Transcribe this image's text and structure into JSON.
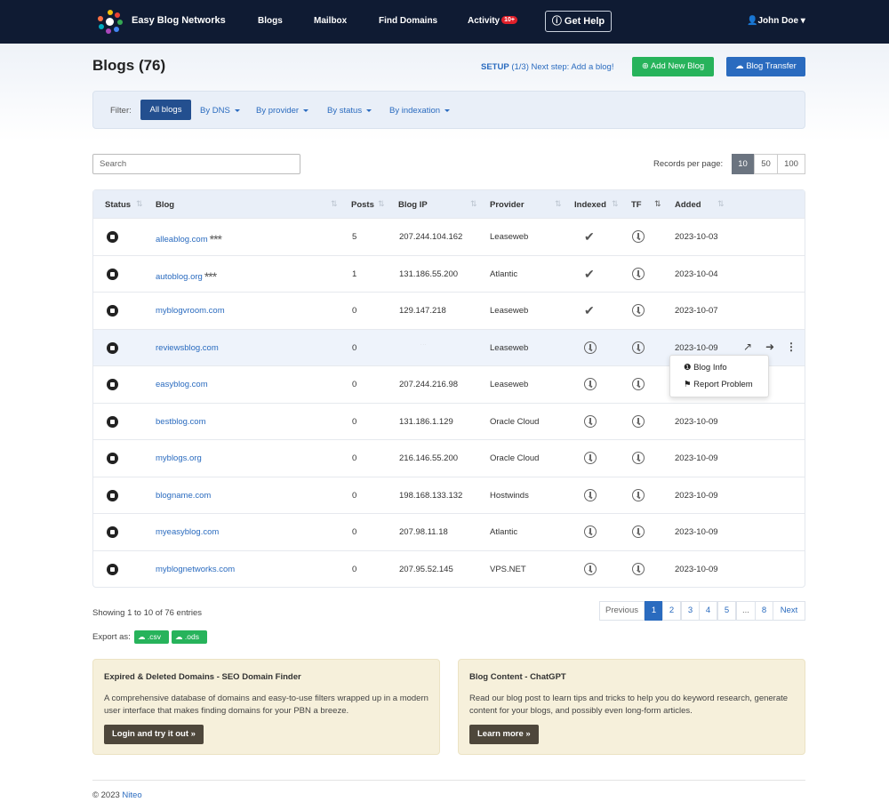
{
  "nav": {
    "brand": "Easy Blog Networks",
    "links": [
      "Blogs",
      "Mailbox",
      "Find Domains",
      "Activity"
    ],
    "activity_badge": "10+",
    "help": "Get Help",
    "user": "John Doe"
  },
  "page": {
    "title": "Blogs (76)",
    "setup_prefix": "SETUP",
    "setup_step": "(1/3)",
    "setup_text": "Next step: Add a blog!",
    "add_button": "Add New Blog",
    "transfer_button": "Blog Transfer"
  },
  "filters": {
    "label": "Filter:",
    "active": "All blogs",
    "dropdowns": [
      "By DNS",
      "By provider",
      "By status",
      "By indexation"
    ]
  },
  "search": {
    "placeholder": "Search"
  },
  "records": {
    "label": "Records per page:",
    "options": [
      "10",
      "50",
      "100"
    ],
    "selected": "10"
  },
  "table": {
    "headers": [
      "Status",
      "Blog",
      "Posts",
      "Blog IP",
      "Provider",
      "Indexed",
      "TF",
      "Added"
    ],
    "rows": [
      {
        "blog": "alleablog.com",
        "stars": "***",
        "posts": "5",
        "ip": "207.244.104.162",
        "provider": "Leaseweb",
        "indexed": "check",
        "added": "2023-10-03"
      },
      {
        "blog": "autoblog.org",
        "stars": "***",
        "posts": "1",
        "ip": "131.186.55.200",
        "provider": "Atlantic",
        "indexed": "check",
        "added": "2023-10-04"
      },
      {
        "blog": "myblogvroom.com",
        "stars": "",
        "posts": "0",
        "ip": "129.147.218",
        "provider": "Leaseweb",
        "indexed": "check",
        "added": "2023-10-07"
      },
      {
        "blog": "reviewsblog.com",
        "stars": "",
        "posts": "0",
        "ip": "",
        "provider": "Leaseweb",
        "indexed": "clock",
        "added": "2023-10-09"
      },
      {
        "blog": "easyblog.com",
        "stars": "",
        "posts": "0",
        "ip": "207.244.216.98",
        "provider": "Leaseweb",
        "indexed": "clock",
        "added": ""
      },
      {
        "blog": "bestblog.com",
        "stars": "",
        "posts": "0",
        "ip": "131.186.1.129",
        "provider": "Oracle Cloud",
        "indexed": "clock",
        "added": "2023-10-09"
      },
      {
        "blog": "myblogs.org",
        "stars": "",
        "posts": "0",
        "ip": "216.146.55.200",
        "provider": "Oracle Cloud",
        "indexed": "clock",
        "added": "2023-10-09"
      },
      {
        "blog": "blogname.com",
        "stars": "",
        "posts": "0",
        "ip": "198.168.133.132",
        "provider": "Hostwinds",
        "indexed": "clock",
        "added": "2023-10-09"
      },
      {
        "blog": "myeasyblog.com",
        "stars": "",
        "posts": "0",
        "ip": "207.98.11.18",
        "provider": "Atlantic",
        "indexed": "clock",
        "added": "2023-10-09"
      },
      {
        "blog": "myblognetworks.com",
        "stars": "",
        "posts": "0",
        "ip": "207.95.52.145",
        "provider": "VPS.NET",
        "indexed": "clock",
        "added": "2023-10-09"
      }
    ]
  },
  "row_menu": {
    "items": [
      "Blog Info",
      "Report Problem"
    ]
  },
  "pagination": {
    "showing": "Showing 1 to 10 of 76 entries",
    "previous": "Previous",
    "pages": [
      "1",
      "2",
      "3",
      "4",
      "5",
      "...",
      "8"
    ],
    "next": "Next",
    "current": "1"
  },
  "export": {
    "label": "Export as:",
    "csv": ".csv",
    "ods": ".ods"
  },
  "promos": [
    {
      "title": "Expired & Deleted Domains - SEO Domain Finder",
      "text": "A comprehensive database of domains and easy-to-use filters wrapped up in a modern user interface that makes finding domains for your PBN a breeze.",
      "button": "Login and try it out »"
    },
    {
      "title": "Blog Content - ChatGPT",
      "text": "Read our blog post to learn tips and tricks to help you do keyword research, generate content for your blogs, and possibly even long-form articles.",
      "button": "Learn more »"
    }
  ],
  "footer": {
    "copyright": "© 2023",
    "company": "Niteo"
  },
  "colors": {
    "nav_bg": "#0f1b33",
    "accent_blue": "#2a6bbf",
    "green": "#27b35b",
    "badge_red": "#e0202a"
  }
}
